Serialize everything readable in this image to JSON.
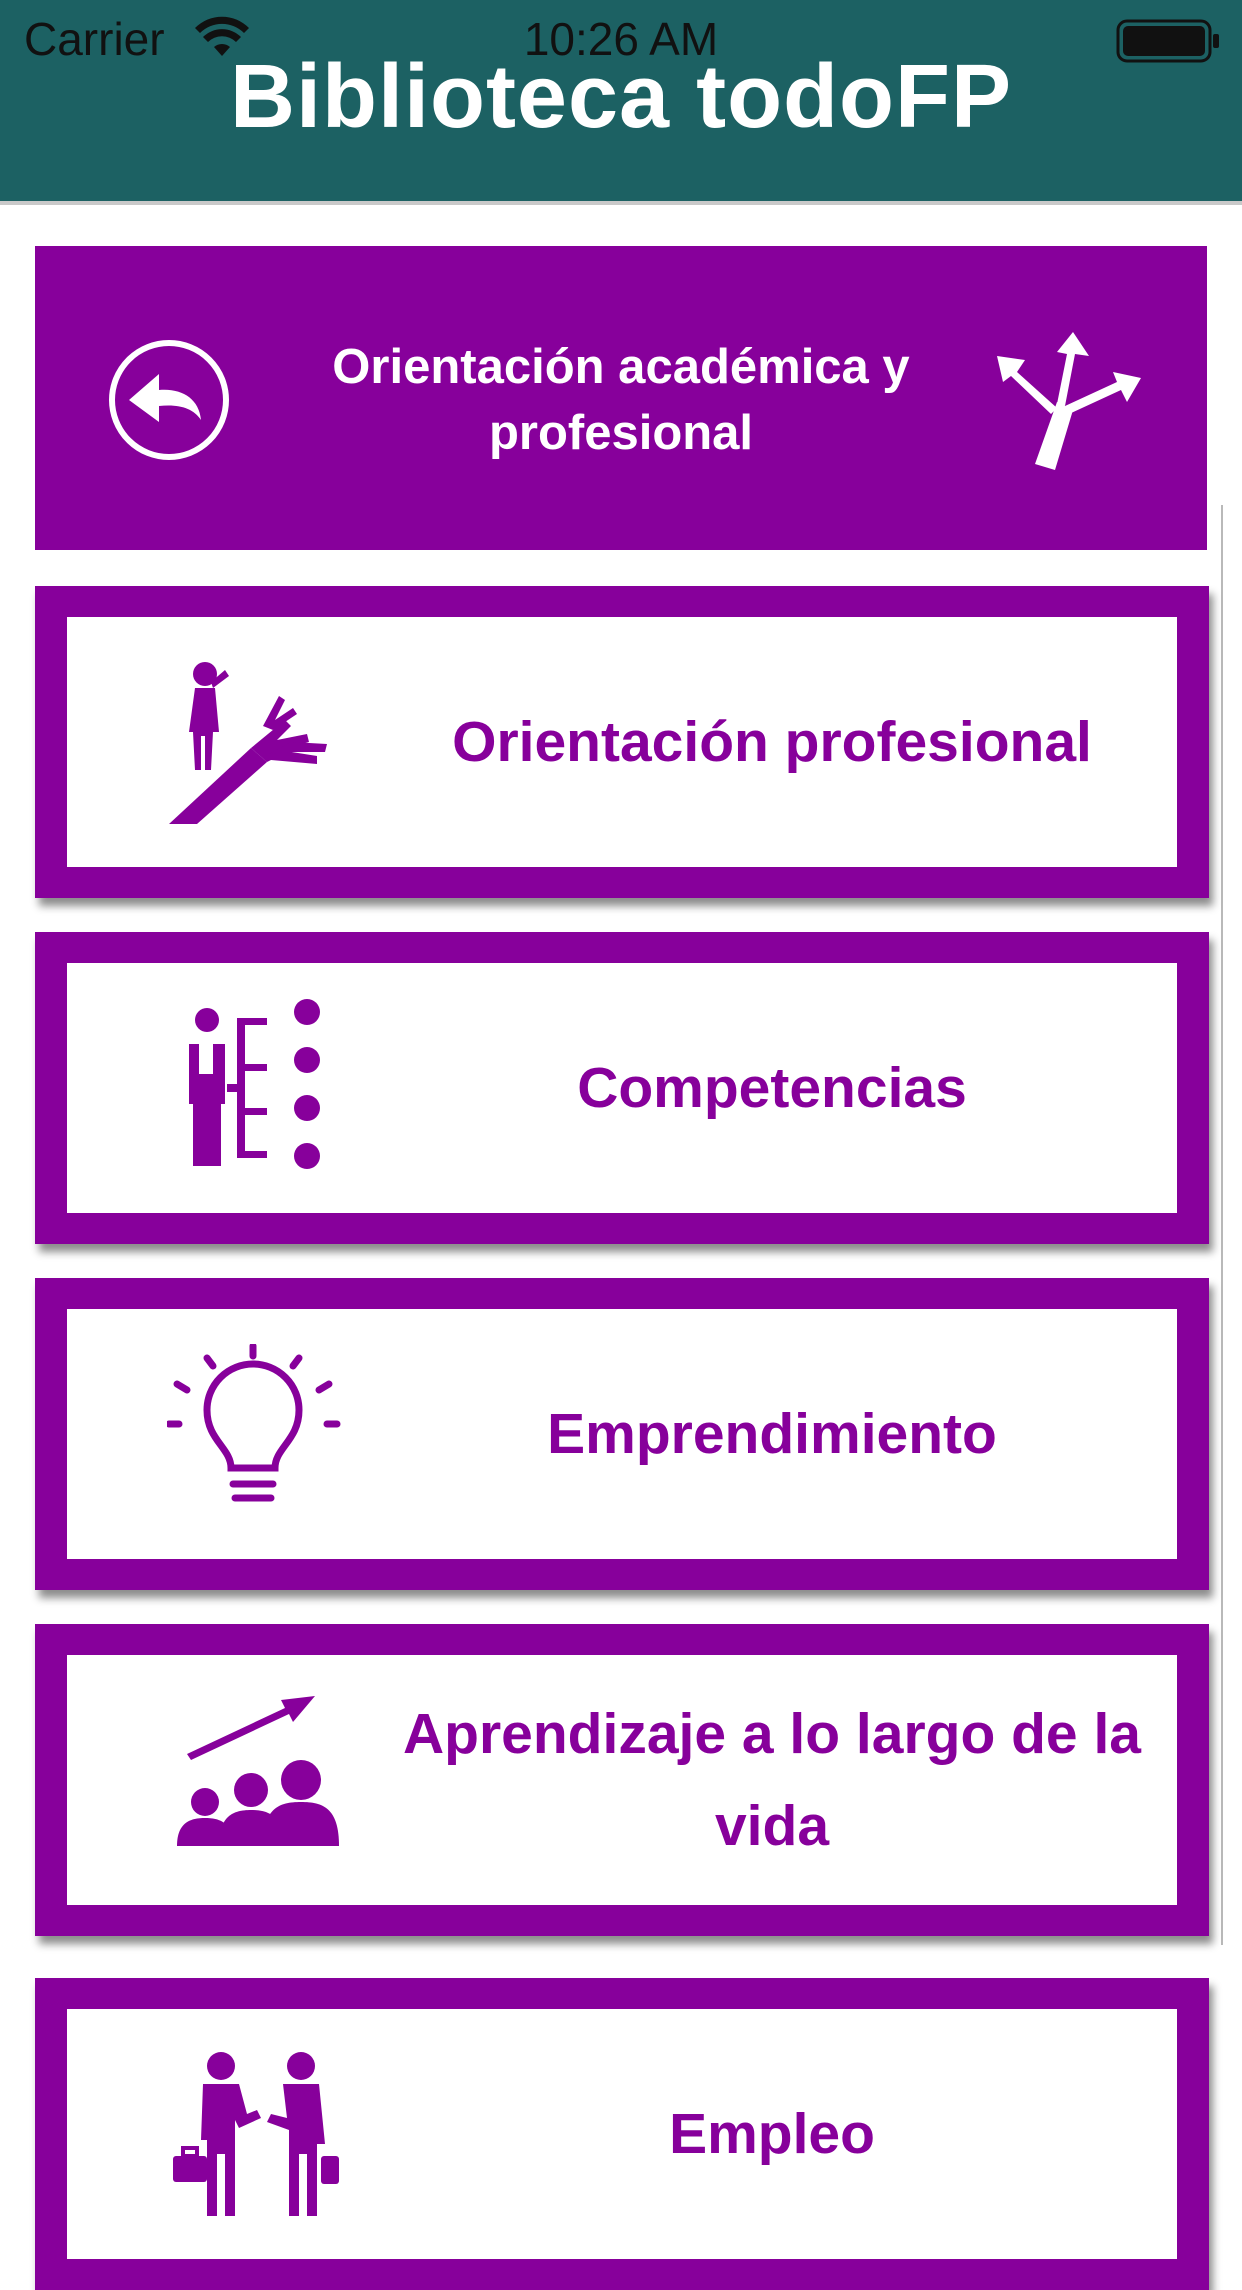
{
  "status_bar": {
    "carrier": "Carrier",
    "time": "10:26 AM",
    "wifi_icon": "wifi-icon",
    "battery_icon": "battery-icon"
  },
  "app_bar": {
    "title": "Biblioteca todoFP",
    "background_color": "#1c6163"
  },
  "header": {
    "title": "Orientación académica y profesional",
    "back_icon": "back-arrow-circle-icon",
    "section_icon": "crossroads-arrows-icon",
    "background_color": "#87009b"
  },
  "menu": {
    "accent_color": "#87009b",
    "items": [
      {
        "label": "Orientación profesional",
        "icon": "person-crossroads-icon"
      },
      {
        "label": "Competencias",
        "icon": "competencies-tree-icon"
      },
      {
        "label": "Emprendimiento",
        "icon": "lightbulb-icon"
      },
      {
        "label": "Aprendizaje a lo largo de la vida",
        "icon": "group-growth-arrow-icon"
      },
      {
        "label": "Empleo",
        "icon": "businessmen-handshake-icon"
      }
    ]
  }
}
